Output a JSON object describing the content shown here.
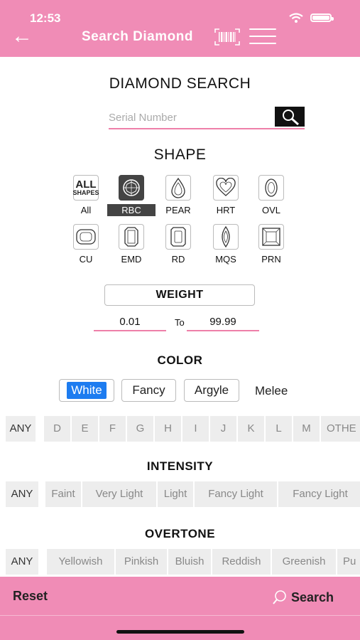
{
  "status": {
    "time": "12:53"
  },
  "nav": {
    "title": "Search Diamond"
  },
  "page": {
    "title": "DIAMOND SEARCH"
  },
  "serial": {
    "placeholder": "Serial Number"
  },
  "shape": {
    "title": "SHAPE",
    "all_icon_top": "ALL",
    "all_icon_bottom": "SHAPES",
    "items": [
      {
        "label": "All",
        "icon": "all-shapes-icon"
      },
      {
        "label": "RBC",
        "icon": "round-brilliant-icon",
        "selected": true
      },
      {
        "label": "PEAR",
        "icon": "pear-icon"
      },
      {
        "label": "HRT",
        "icon": "heart-icon"
      },
      {
        "label": "OVL",
        "icon": "oval-icon"
      },
      {
        "label": "CU",
        "icon": "cushion-icon"
      },
      {
        "label": "EMD",
        "icon": "emerald-icon"
      },
      {
        "label": "RD",
        "icon": "radiant-icon"
      },
      {
        "label": "MQS",
        "icon": "marquise-icon"
      },
      {
        "label": "PRN",
        "icon": "princess-icon"
      }
    ]
  },
  "weight": {
    "title": "WEIGHT",
    "from": "0.01",
    "to_label": "To",
    "to": "99.99"
  },
  "color": {
    "title": "COLOR",
    "types": [
      "White",
      "Fancy",
      "Argyle"
    ],
    "active": "White",
    "melee": "Melee",
    "grades": [
      "ANY",
      "D",
      "E",
      "F",
      "G",
      "H",
      "I",
      "J",
      "K",
      "L",
      "M",
      "OTHE"
    ]
  },
  "intensity": {
    "title": "INTENSITY",
    "options": [
      "ANY",
      "Faint",
      "Very Light",
      "Light",
      "Fancy Light",
      "Fancy Light"
    ]
  },
  "overtone": {
    "title": "OVERTONE",
    "options": [
      "ANY",
      "Yellowish",
      "Pinkish",
      "Bluish",
      "Reddish",
      "Greenish",
      "Pu"
    ]
  },
  "footer": {
    "reset": "Reset",
    "search": "Search"
  },
  "colors": {
    "brand_pink": "#f08cb6",
    "accent_blue": "#1d7cf0",
    "underline_pink": "#ee7fa9",
    "selected_dark": "#444444"
  }
}
